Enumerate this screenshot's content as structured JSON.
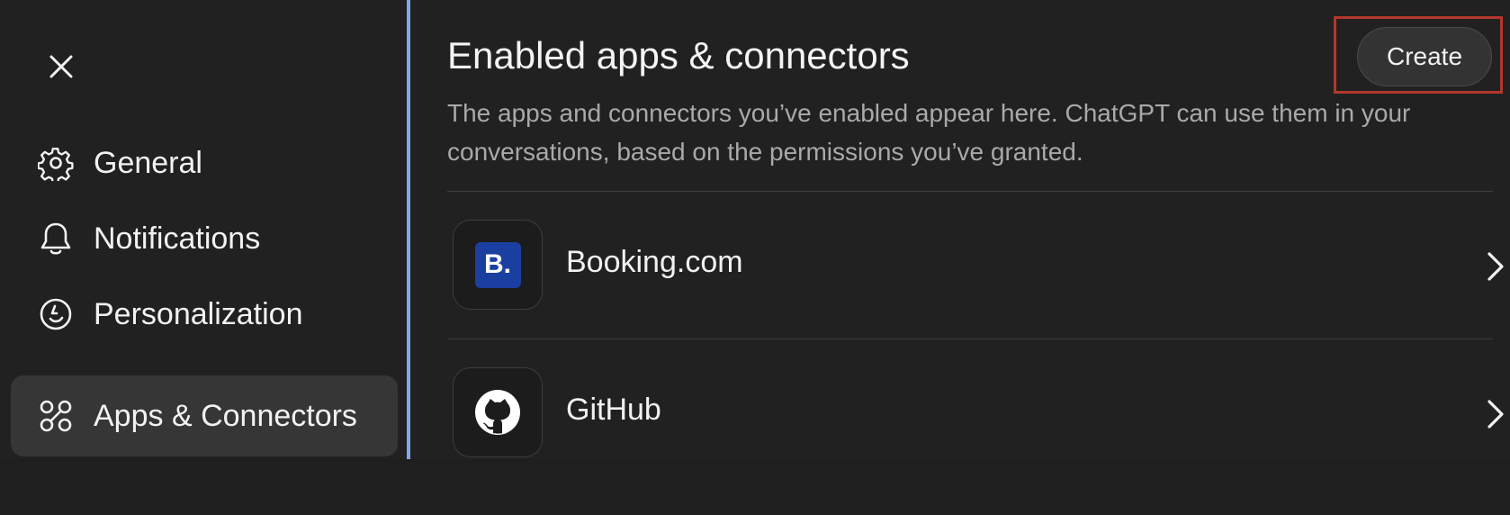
{
  "sidebar": {
    "close_icon": "close-icon",
    "items": [
      {
        "label": "General",
        "icon": "gear-icon",
        "active": false
      },
      {
        "label": "Notifications",
        "icon": "bell-icon",
        "active": false
      },
      {
        "label": "Personalization",
        "icon": "smile-face-icon",
        "active": false
      },
      {
        "label": "Apps & Connectors",
        "icon": "apps-connectors-icon",
        "active": true
      }
    ]
  },
  "main": {
    "title": "Enabled apps & connectors",
    "create_label": "Create",
    "description": "The apps and connectors you’ve enabled appear here. ChatGPT can use them in your conversations, based on the permissions you’ve granted.",
    "apps": [
      {
        "name": "Booking.com",
        "logo_text": "B.",
        "icon": "booking-logo-icon"
      },
      {
        "name": "GitHub",
        "icon": "github-icon"
      }
    ]
  },
  "colors": {
    "background": "#212121",
    "active_nav": "#363636",
    "accent_strip": "#7fa9e6",
    "highlight_box": "#b3372b",
    "booking_blue": "#1a3fa0"
  }
}
